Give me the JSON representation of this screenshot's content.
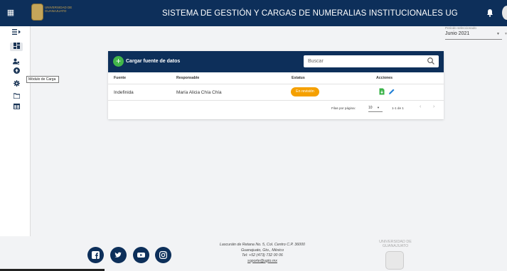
{
  "header": {
    "title": "SISTEMA DE GESTIÓN Y CARGAS DE NUMERALIAS INSTITUCIONALES UG",
    "logo_text": "UNIVERSIDAD DE GUANAJUATO",
    "colors": {
      "primary": "#0d2f5a",
      "accent_gold": "#c9a24c"
    }
  },
  "period": {
    "label": "Periodo seleccionado",
    "value": "Junio 2021"
  },
  "sidebar": {
    "items": [
      {
        "icon": "collapse-menu-icon",
        "glyph": "≡▸"
      },
      {
        "icon": "dashboard-icon",
        "glyph": "▦"
      },
      {
        "icon": "users-icon",
        "glyph": "👥"
      },
      {
        "icon": "upload-module-icon",
        "glyph": "⬆"
      },
      {
        "icon": "settings-icon",
        "glyph": "⚙"
      },
      {
        "icon": "folder-icon",
        "glyph": "▭"
      },
      {
        "icon": "table-icon",
        "glyph": "▤"
      }
    ],
    "tooltip": "Módulo de Carga"
  },
  "card": {
    "add_label": "Cargar fuente de datos",
    "search_placeholder": "Buscar",
    "columns": [
      "Fuente",
      "Responsable",
      "Estatus",
      "Acciones"
    ],
    "rows": [
      {
        "fuente": "Indefinida",
        "responsable": "María Alicia Chía Chía",
        "estatus": "En revisión"
      }
    ],
    "status_color": "#f5a000",
    "pagination": {
      "rows_label": "Filas por página:",
      "rows_value": "10",
      "range": "1-1 de 1"
    }
  },
  "footer": {
    "social": [
      "facebook-icon",
      "twitter-icon",
      "youtube-icon",
      "instagram-icon"
    ],
    "address_line1": "Lascuráin de Retana No. 5, Col. Centro C.P. 36000",
    "address_line2": "Guanajuato, Gto., México",
    "phone": "Tel: +52 (473) 732 00 06",
    "email": "soporte@ugto.mx",
    "university": "UNIVERSIDAD DE GUANAJUATO"
  }
}
